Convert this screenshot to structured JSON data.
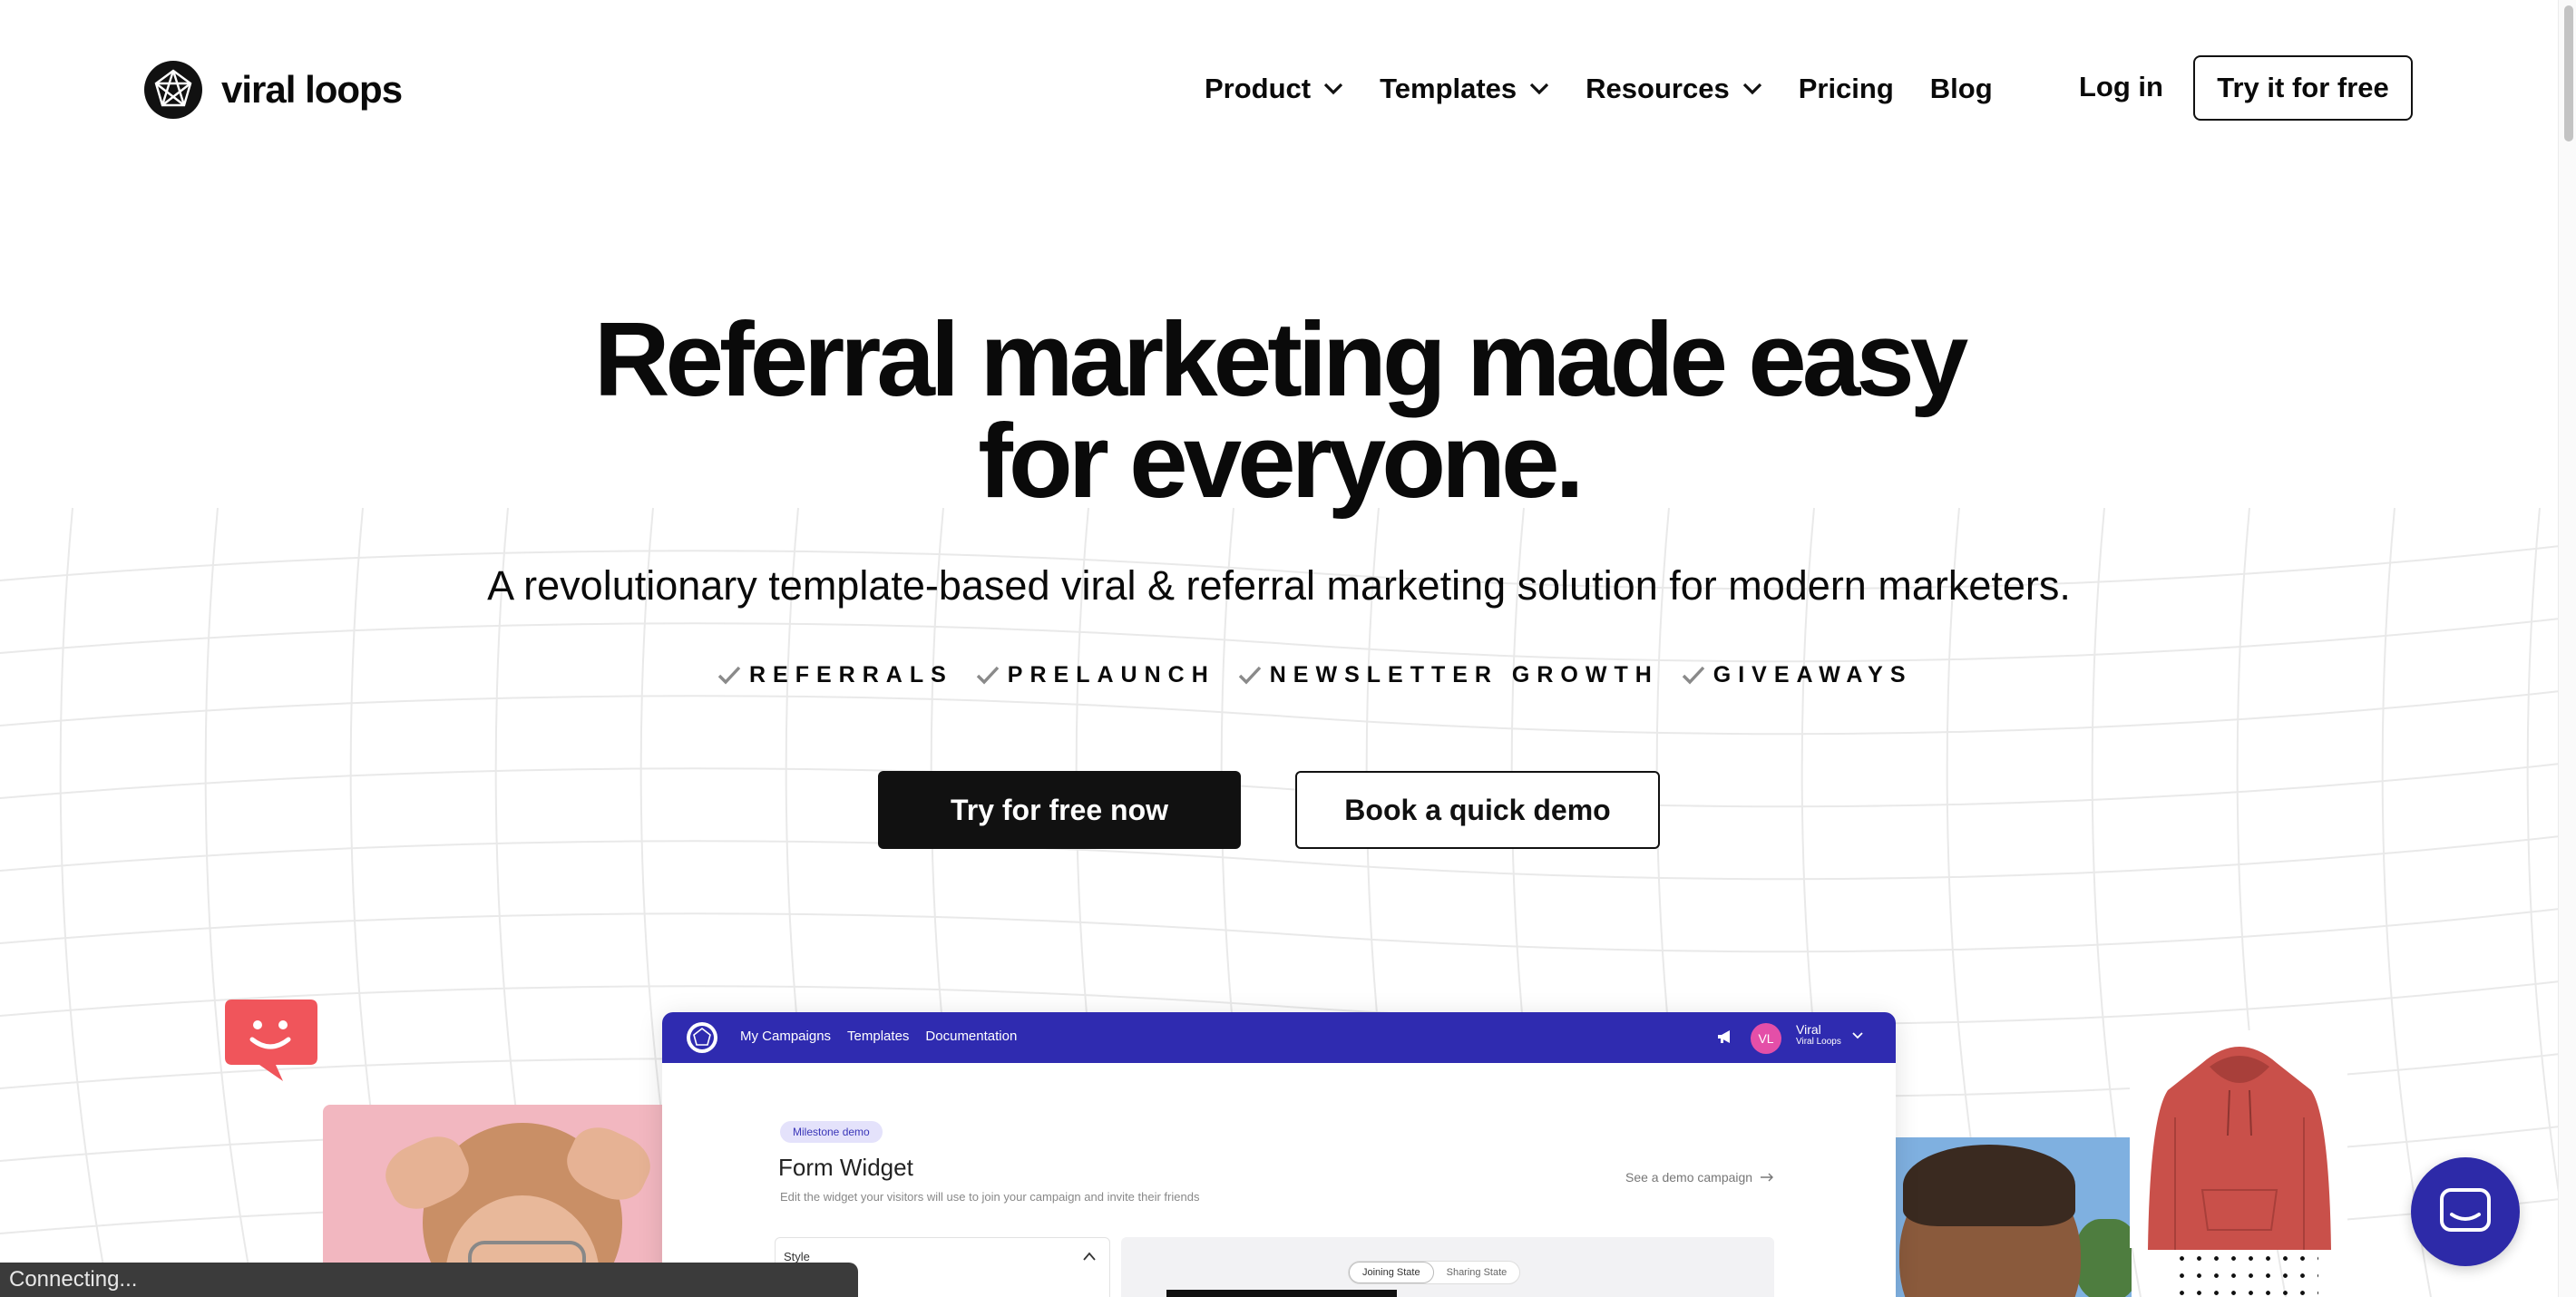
{
  "brand": {
    "name": "viral loops"
  },
  "nav": {
    "items": [
      {
        "label": "Product",
        "dropdown": true
      },
      {
        "label": "Templates",
        "dropdown": true
      },
      {
        "label": "Resources",
        "dropdown": true
      },
      {
        "label": "Pricing",
        "dropdown": false
      },
      {
        "label": "Blog",
        "dropdown": false
      }
    ],
    "login_label": "Log in",
    "cta_label": "Try it for free"
  },
  "hero": {
    "title_line1": "Referral marketing made easy",
    "title_line2": "for everyone.",
    "subtitle": "A revolutionary template-based viral & referral marketing solution for modern marketers.",
    "tags": [
      "REFERRALS",
      "PRELAUNCH",
      "NEWSLETTER GROWTH",
      "GIVEAWAYS"
    ],
    "primary_button": "Try for free now",
    "secondary_button": "Book a quick demo"
  },
  "dashboard": {
    "nav": [
      "My Campaigns",
      "Templates",
      "Documentation"
    ],
    "avatar_initials": "VL",
    "user_name": "Viral",
    "user_org": "Viral Loops",
    "chip": "Milestone demo",
    "title": "Form Widget",
    "description": "Edit the widget your visitors will use to join your campaign and invite their friends",
    "demo_link": "See a demo campaign",
    "style_label": "Style",
    "toggle": [
      "Joining State",
      "Sharing State"
    ]
  },
  "status_bar": {
    "text": "Connecting..."
  },
  "colors": {
    "accent_blue": "#2f2bb0",
    "smiley_red": "#f0555b",
    "avatar_pink": "#e44fa8",
    "hoodie_red": "#c9504a"
  },
  "icons": {
    "logo": "star-in-circle-icon",
    "chevrons": "chevron-down-icon",
    "tag_check": "check-icon",
    "chat": "chat-icon",
    "smiley": "smiley-chat-icon"
  }
}
